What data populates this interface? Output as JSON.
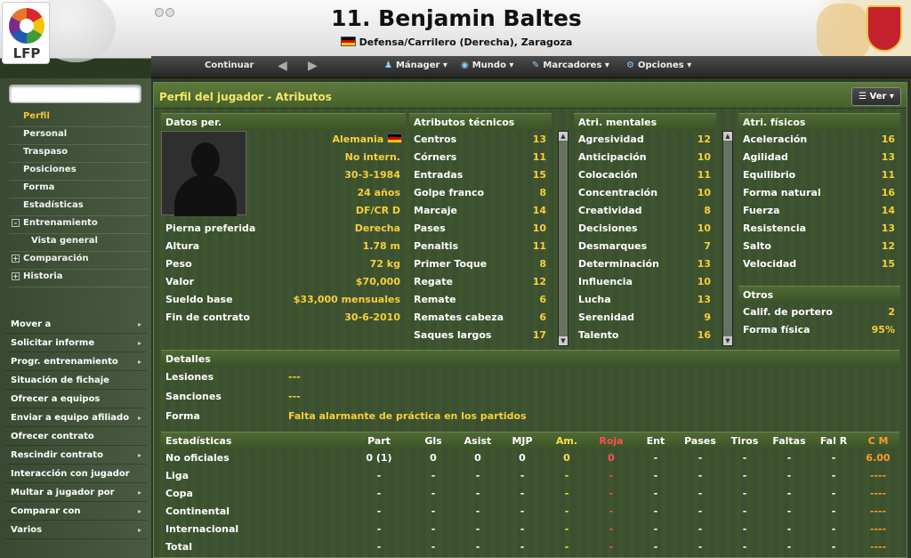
{
  "header": {
    "logo_text": "LFP",
    "player_title": "11. Benjamin Baltes",
    "player_subtitle": "Defensa/Carrilero (Derecha), Zaragoza"
  },
  "toolbar": {
    "continue_label": "Continuar",
    "menus": [
      "Mánager",
      "Mundo",
      "Marcadores",
      "Opciones"
    ]
  },
  "sidebar": {
    "nav": [
      {
        "label": "Perfil"
      },
      {
        "label": "Personal"
      },
      {
        "label": "Traspaso"
      },
      {
        "label": "Posiciones"
      },
      {
        "label": "Forma"
      },
      {
        "label": "Estadísticas"
      },
      {
        "label": "Entrenamiento"
      },
      {
        "label": "Vista general"
      },
      {
        "label": "Comparación"
      },
      {
        "label": "Historia"
      }
    ],
    "actions": [
      "Mover a",
      "Solicitar informe",
      "Progr. entrenamiento",
      "Situación de fichaje",
      "Ofrecer a equipos",
      "Enviar a equipo afiliado",
      "Ofrecer contrato",
      "Rescindir contrato",
      "Interacción con jugador",
      "Multar a jugador por",
      "Comparar con",
      "Varios"
    ]
  },
  "panel": {
    "title": "Perfil del jugador - Atributos",
    "view_button": "Ver"
  },
  "personal": {
    "header": "Datos per.",
    "nationality": "Alemania",
    "intl": "No intern.",
    "dob": "30-3-1984",
    "age": "24 años",
    "position": "DF/CR D",
    "rows": [
      {
        "label": "Pierna preferida",
        "value": "Derecha"
      },
      {
        "label": "Altura",
        "value": "1.78 m"
      },
      {
        "label": "Peso",
        "value": "72 kg"
      },
      {
        "label": "Valor",
        "value": "$70,000"
      },
      {
        "label": "Sueldo base",
        "value": "$33,000 mensuales"
      },
      {
        "label": "Fin de contrato",
        "value": "30-6-2010"
      }
    ]
  },
  "technical": {
    "header": "Atributos técnicos",
    "rows": [
      {
        "label": "Centros",
        "value": "13"
      },
      {
        "label": "Córners",
        "value": "11"
      },
      {
        "label": "Entradas",
        "value": "15"
      },
      {
        "label": "Golpe franco",
        "value": "8"
      },
      {
        "label": "Marcaje",
        "value": "14"
      },
      {
        "label": "Pases",
        "value": "10"
      },
      {
        "label": "Penaltis",
        "value": "11"
      },
      {
        "label": "Primer Toque",
        "value": "8"
      },
      {
        "label": "Regate",
        "value": "12"
      },
      {
        "label": "Remate",
        "value": "6"
      },
      {
        "label": "Remates cabeza",
        "value": "6"
      },
      {
        "label": "Saques largos",
        "value": "17"
      }
    ]
  },
  "mental": {
    "header": "Atri. mentales",
    "rows": [
      {
        "label": "Agresividad",
        "value": "12"
      },
      {
        "label": "Anticipación",
        "value": "10"
      },
      {
        "label": "Colocación",
        "value": "11"
      },
      {
        "label": "Concentración",
        "value": "10"
      },
      {
        "label": "Creatividad",
        "value": "8"
      },
      {
        "label": "Decisiones",
        "value": "10"
      },
      {
        "label": "Desmarques",
        "value": "7"
      },
      {
        "label": "Determinación",
        "value": "13"
      },
      {
        "label": "Influencia",
        "value": "10"
      },
      {
        "label": "Lucha",
        "value": "13"
      },
      {
        "label": "Serenidad",
        "value": "9"
      },
      {
        "label": "Talento",
        "value": "16"
      }
    ]
  },
  "physical": {
    "header": "Atri. físicos",
    "rows": [
      {
        "label": "Aceleración",
        "value": "16"
      },
      {
        "label": "Agilidad",
        "value": "13"
      },
      {
        "label": "Equilibrio",
        "value": "11"
      },
      {
        "label": "Forma natural",
        "value": "16"
      },
      {
        "label": "Fuerza",
        "value": "14"
      },
      {
        "label": "Resistencia",
        "value": "13"
      },
      {
        "label": "Salto",
        "value": "12"
      },
      {
        "label": "Velocidad",
        "value": "15"
      }
    ]
  },
  "others": {
    "header": "Otros",
    "rows": [
      {
        "label": "Calif. de portero",
        "value": "2"
      },
      {
        "label": "Forma física",
        "value": "95%"
      }
    ]
  },
  "details": {
    "header": "Detalles",
    "rows": [
      {
        "label": "Lesiones",
        "value": "---"
      },
      {
        "label": "Sanciones",
        "value": "---"
      },
      {
        "label": "Forma",
        "value": "Falta alarmante de práctica en los partidos"
      }
    ]
  },
  "stats": {
    "header": "Estadísticas",
    "columns": [
      "Part",
      "Gls",
      "Asist",
      "MJP",
      "Am.",
      "Roja",
      "Ent",
      "Pases",
      "Tiros",
      "Faltas",
      "Fal R",
      "C M"
    ],
    "rows": [
      {
        "label": "No oficiales",
        "values": [
          "0 (1)",
          "0",
          "0",
          "0",
          "0",
          "0",
          "-",
          "-",
          "-",
          "-",
          "-",
          "6.00"
        ]
      },
      {
        "label": "Liga",
        "values": [
          "-",
          "-",
          "-",
          "-",
          "-",
          "-",
          "-",
          "-",
          "-",
          "-",
          "-",
          "----"
        ]
      },
      {
        "label": "Copa",
        "values": [
          "-",
          "-",
          "-",
          "-",
          "-",
          "-",
          "-",
          "-",
          "-",
          "-",
          "-",
          "----"
        ]
      },
      {
        "label": "Continental",
        "values": [
          "-",
          "-",
          "-",
          "-",
          "-",
          "-",
          "-",
          "-",
          "-",
          "-",
          "-",
          "----"
        ]
      },
      {
        "label": "Internacional",
        "values": [
          "-",
          "-",
          "-",
          "-",
          "-",
          "-",
          "-",
          "-",
          "-",
          "-",
          "-",
          "----"
        ]
      },
      {
        "label": "Total",
        "values": [
          "-",
          "-",
          "-",
          "-",
          "-",
          "-",
          "-",
          "-",
          "-",
          "-",
          "-",
          "----"
        ]
      }
    ]
  }
}
